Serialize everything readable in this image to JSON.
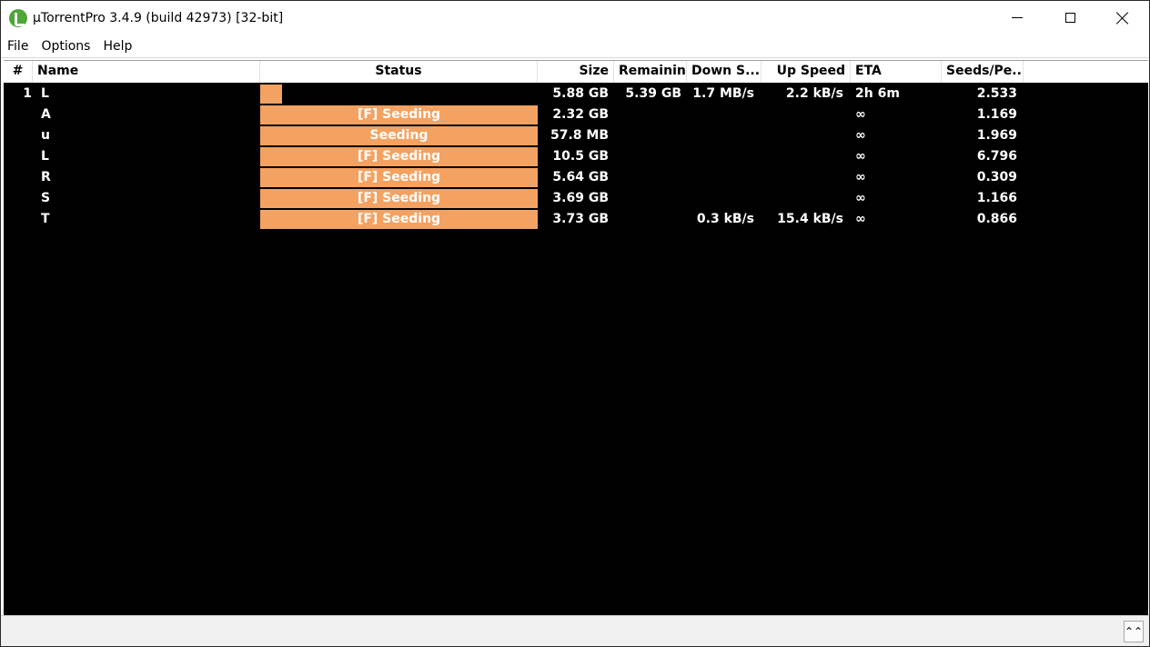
{
  "window": {
    "title": "µTorrentPro 3.4.9  (build 42973) [32-bit]"
  },
  "menu": [
    "File",
    "Options",
    "Help"
  ],
  "columns": {
    "num": "#",
    "name": "Name",
    "status": "Status",
    "size": "Size",
    "remaining": "Remaining",
    "down": "Down S...",
    "up": "Up Speed",
    "eta": "ETA",
    "seeds": "Seeds/Pe..."
  },
  "rows": [
    {
      "num": "1",
      "name": "L",
      "status": "",
      "progress": 0.08,
      "size": "5.88 GB",
      "remaining": "5.39 GB",
      "down": "1.7 MB/s",
      "up": "2.2 kB/s",
      "eta": "2h 6m",
      "seeds": "2.533"
    },
    {
      "num": "",
      "name": "A",
      "status": "[F] Seeding",
      "progress": 1.0,
      "size": "2.32 GB",
      "remaining": "",
      "down": "",
      "up": "",
      "eta": "∞",
      "seeds": "1.169"
    },
    {
      "num": "",
      "name": "u",
      "status": "Seeding",
      "progress": 1.0,
      "size": "57.8 MB",
      "remaining": "",
      "down": "",
      "up": "",
      "eta": "∞",
      "seeds": "1.969"
    },
    {
      "num": "",
      "name": "L",
      "status": "[F] Seeding",
      "progress": 1.0,
      "size": "10.5 GB",
      "remaining": "",
      "down": "",
      "up": "",
      "eta": "∞",
      "seeds": "6.796"
    },
    {
      "num": "",
      "name": "R",
      "status": "[F] Seeding",
      "progress": 1.0,
      "size": "5.64 GB",
      "remaining": "",
      "down": "",
      "up": "",
      "eta": "∞",
      "seeds": "0.309"
    },
    {
      "num": "",
      "name": "S",
      "status": "[F] Seeding",
      "progress": 1.0,
      "size": "3.69 GB",
      "remaining": "",
      "down": "",
      "up": "",
      "eta": "∞",
      "seeds": "1.166"
    },
    {
      "num": "",
      "name": "T",
      "status": "[F] Seeding",
      "progress": 1.0,
      "size": "3.73 GB",
      "remaining": "",
      "down": "0.3 kB/s",
      "up": "15.4 kB/s",
      "eta": "∞",
      "seeds": "0.866"
    }
  ],
  "bottom": {
    "expand_icon": "double-chevron-up-icon",
    "expand_glyph": "⌃⌃"
  },
  "colors": {
    "progress": "#f4a261",
    "list_background": "#000000"
  }
}
